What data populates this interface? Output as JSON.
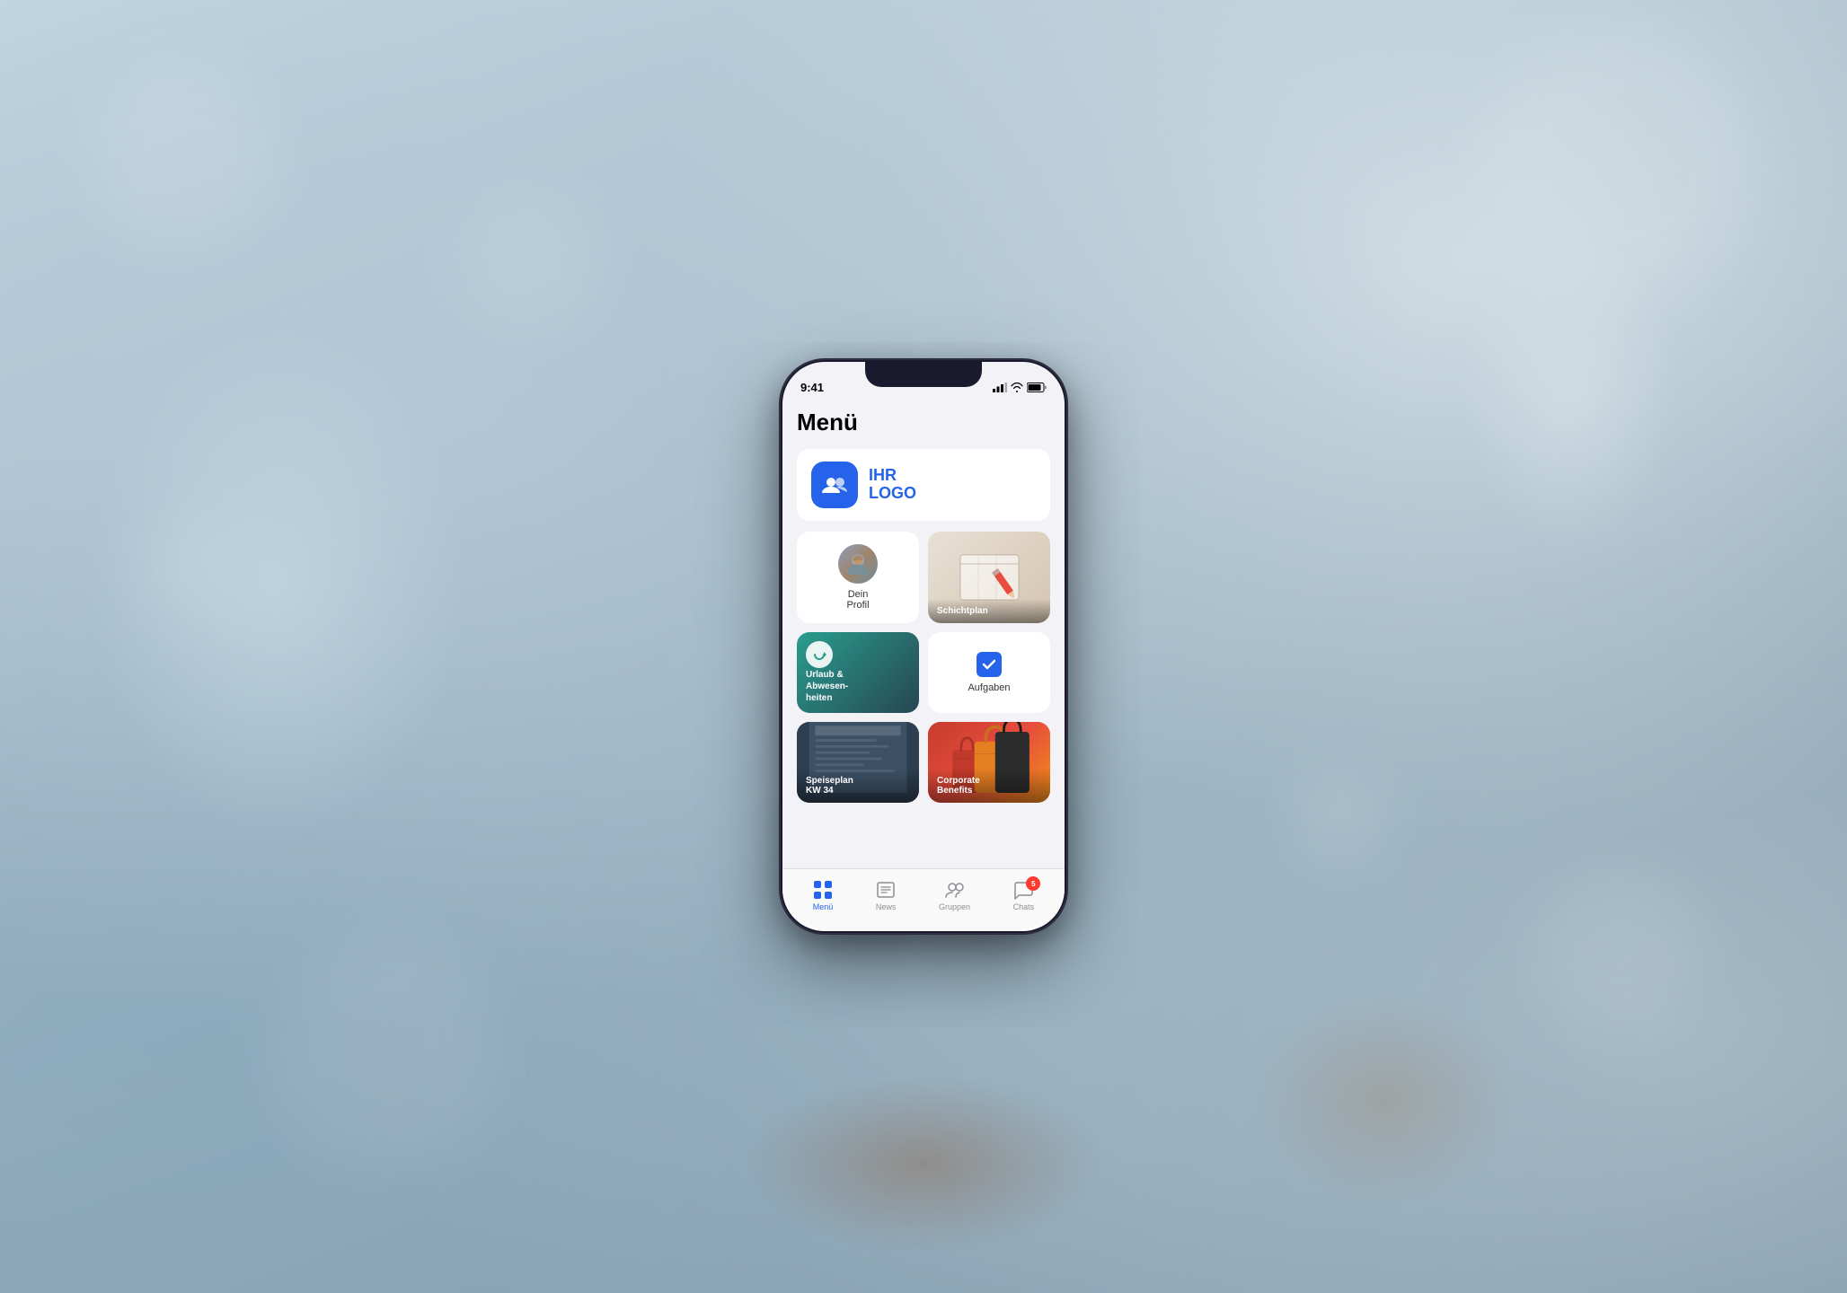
{
  "background": {
    "color": "#b0c8d8"
  },
  "phone": {
    "status_bar": {
      "time": "9:41",
      "signal": "●●●",
      "wifi": "wifi",
      "battery": "battery"
    },
    "screen_title": "Menü",
    "logo": {
      "text_line1": "IHR",
      "text_line2": "LOGO"
    },
    "menu_items": [
      {
        "id": "profil",
        "label": "Dein\nProfil",
        "type": "profile",
        "has_avatar": true
      },
      {
        "id": "schichtplan",
        "label": "Schichtplan",
        "type": "schichtplan"
      },
      {
        "id": "urlaub",
        "label": "Urlaub &\nAbwesen-\nheiten",
        "type": "teal"
      },
      {
        "id": "aufgaben",
        "label": "Aufgaben",
        "type": "check"
      },
      {
        "id": "speiseplan",
        "label": "Speiseplan\nKW 34",
        "type": "speiseplan"
      },
      {
        "id": "corporate",
        "label": "Corporate\nBenefits",
        "type": "corporate"
      }
    ],
    "tab_bar": {
      "items": [
        {
          "id": "menu",
          "label": "Menü",
          "icon": "grid",
          "active": true,
          "badge": null
        },
        {
          "id": "news",
          "label": "News",
          "icon": "news",
          "active": false,
          "badge": null
        },
        {
          "id": "gruppen",
          "label": "Gruppen",
          "icon": "gruppen",
          "active": false,
          "badge": null
        },
        {
          "id": "chats",
          "label": "Chats",
          "icon": "chats",
          "active": false,
          "badge": "5"
        }
      ]
    }
  }
}
